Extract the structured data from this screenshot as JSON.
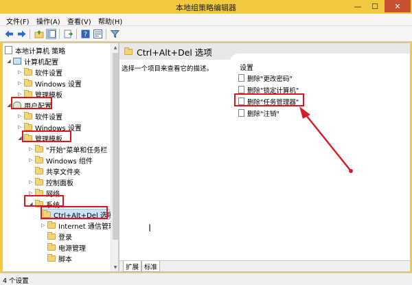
{
  "window": {
    "title": "本地组策略编辑器",
    "min_glyph": "—",
    "max_glyph": "☐",
    "close_glyph": "✕"
  },
  "menu": [
    "文件(F)",
    "操作(A)",
    "查看(V)",
    "帮助(H)"
  ],
  "tree": {
    "root": "本地计算机 策略",
    "computer": "计算机配置",
    "computer_software": "软件设置",
    "computer_windows": "Windows 设置",
    "computer_admin": "管理模板",
    "user": "用户配置",
    "user_software": "软件设置",
    "user_windows": "Windows 设置",
    "user_admin": "管理模板",
    "start_menu": "\"开始\"菜单和任务栏",
    "win_components": "Windows 组件",
    "shared_folders": "共享文件夹",
    "control_panel": "控制面板",
    "network": "网络",
    "system": "系统",
    "cad": "Ctrl+Alt+Del 选项",
    "internet_comm": "Internet 通信管理",
    "logon": "登录",
    "power": "电源管理",
    "scripts": "脚本"
  },
  "right": {
    "header": "Ctrl+Alt+Del 选项",
    "description": "选择一个项目来查看它的描述。",
    "settings_header": "设置",
    "settings": [
      "删除\"更改密码\"",
      "删除\"锁定计算机\"",
      "删除\"任务管理器\"",
      "删除\"注销\""
    ]
  },
  "tabs": [
    "扩展",
    "标准"
  ],
  "status": "4 个设置",
  "colors": {
    "titlebar": "#f0c93e",
    "highlight": "#e0121b",
    "selection": "#cce4f7"
  }
}
